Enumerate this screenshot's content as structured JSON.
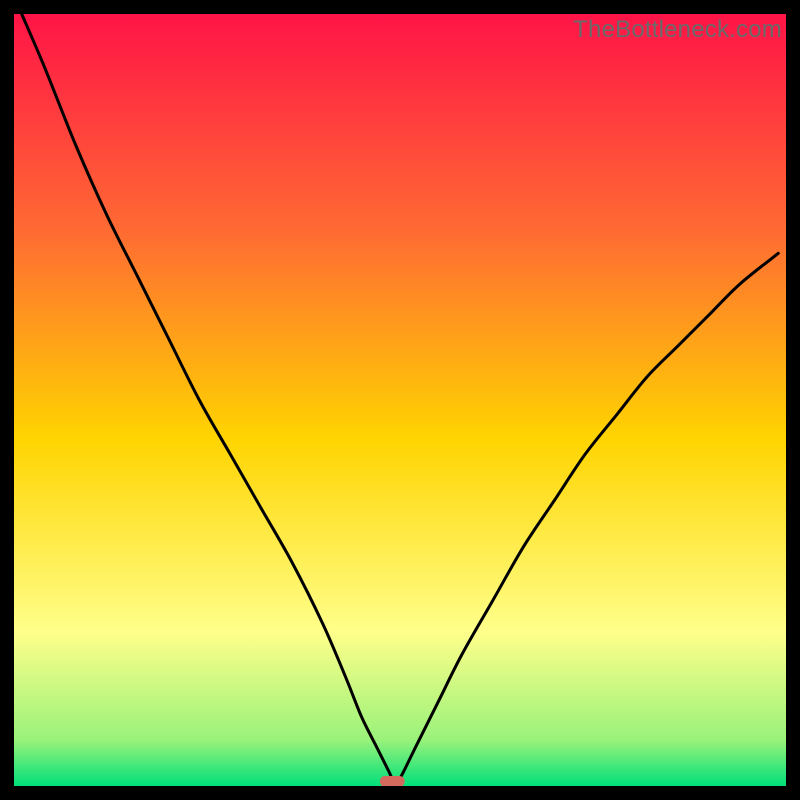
{
  "watermark": "TheBottleneck.com",
  "chart_data": {
    "type": "line",
    "title": "",
    "xlabel": "",
    "ylabel": "",
    "xlim": [
      0,
      100
    ],
    "ylim": [
      0,
      100
    ],
    "grid": false,
    "legend": false,
    "gradient_colors": {
      "top": "#ff1447",
      "upper_mid": "#ff6a33",
      "mid": "#ffd400",
      "lower_mid": "#ffff8a",
      "near_bottom": "#9af27a",
      "bottom": "#00e07a"
    },
    "series": [
      {
        "name": "bottleneck-curve",
        "x": [
          1,
          4,
          8,
          12,
          16,
          20,
          24,
          28,
          32,
          36,
          40,
          43,
          45,
          47,
          48.5,
          49,
          49.5,
          50,
          52,
          55,
          58,
          62,
          66,
          70,
          74,
          78,
          82,
          86,
          90,
          94,
          99
        ],
        "y": [
          100,
          93,
          83,
          74,
          66,
          58,
          50,
          43,
          36,
          29,
          21,
          14,
          9,
          5,
          2,
          1,
          1,
          1,
          5,
          11,
          17,
          24,
          31,
          37,
          43,
          48,
          53,
          57,
          61,
          65,
          69
        ]
      }
    ],
    "minimum_marker": {
      "shape": "rounded-rect",
      "color": "#d46a5e",
      "x_center": 49,
      "y_center": 0.6,
      "width": 3.2,
      "height": 1.4
    }
  }
}
